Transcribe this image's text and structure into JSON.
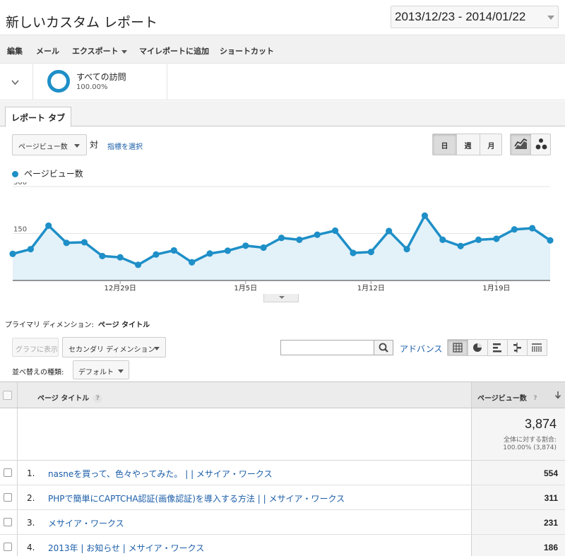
{
  "header": {
    "title": "新しいカスタム レポート",
    "date_range": "2013/12/23 - 2014/01/22"
  },
  "toolbar": {
    "items": [
      "編集",
      "メール",
      "エクスポート",
      "マイレポートに追加",
      "ショートカット"
    ]
  },
  "segment": {
    "label": "すべての訪問",
    "percent": "100.00%",
    "color": "#1e8fc7"
  },
  "tabs": {
    "report_tab": "レポート タブ"
  },
  "chart_controls": {
    "metric_select": "ページビュー数",
    "vs_label": "対",
    "select_metric_link": "指標を選択",
    "period_buttons": [
      "日",
      "週",
      "月"
    ],
    "active_period": "日",
    "chart_types": [
      "line-chart-icon",
      "motion-chart-icon"
    ]
  },
  "chart_data": {
    "type": "area",
    "title": "",
    "series": [
      {
        "name": "ページビュー数",
        "color": "#1e8fc7",
        "values": [
          85,
          100,
          175,
          120,
          122,
          78,
          74,
          50,
          83,
          96,
          58,
          86,
          95,
          111,
          105,
          136,
          130,
          146,
          159,
          88,
          91,
          158,
          100,
          207,
          130,
          110,
          130,
          133,
          163,
          167,
          128
        ]
      }
    ],
    "x_tick_labels": [
      "12月29日",
      "1月5日",
      "1月12日",
      "1月19日"
    ],
    "x_tick_indices": [
      6,
      13,
      20,
      27
    ],
    "y_tick_labels": [
      "300",
      "150"
    ],
    "ylim": [
      0,
      300
    ],
    "grid": true,
    "fill_color": "#e3f1f9"
  },
  "table_controls": {
    "primary_dimension_label": "プライマリ ディメンション:",
    "primary_dimension_value": "ページ タイトル",
    "graph_button": "グラフに表示",
    "secondary_dimension": "セカンダリ ディメンション",
    "search_placeholder": "",
    "advanced_link": "アドバンス",
    "sort_label": "並べ替えの種類:",
    "sort_value": "デフォルト"
  },
  "table": {
    "columns": {
      "title": "ページ タイトル",
      "metric": "ページビュー数",
      "help": "?"
    },
    "total": {
      "value": "3,874",
      "label": "全体に対する割合:",
      "percent": "100.00% (3,874)"
    },
    "rows": [
      {
        "index": "1.",
        "title": "nasneを買って、色々やってみた。 | | メサイア・ワークス",
        "value": "554"
      },
      {
        "index": "2.",
        "title": "PHPで簡単にCAPTCHA認証(画像認証)を導入する方法 | | メサイア・ワークス",
        "value": "311"
      },
      {
        "index": "3.",
        "title": "メサイア・ワークス",
        "value": "231"
      },
      {
        "index": "4.",
        "title": "2013年 | お知らせ | メサイア・ワークス",
        "value": "186"
      }
    ]
  }
}
